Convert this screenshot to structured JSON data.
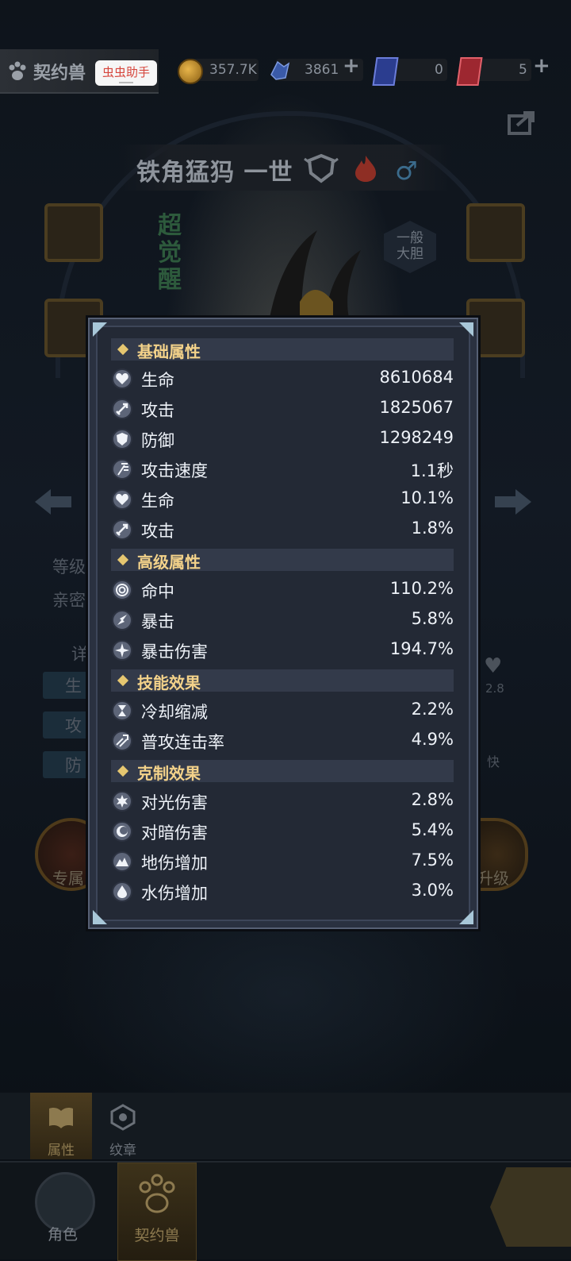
{
  "topbar": {
    "title": "契约兽",
    "helper_badge": "虫虫助手",
    "gold": "357.7K",
    "crystals": "3861",
    "card_blue": "0",
    "card_red": "5"
  },
  "scene": {
    "monster_name": "铁角猛犸 一世",
    "super_awaken": "超觉醒",
    "personality_line1": "一般",
    "personality_line2": "大胆",
    "level_label": "等级",
    "intimacy_label": "亲密",
    "detail_label": "详",
    "side_hp": "生",
    "side_atk": "攻",
    "side_def": "防",
    "right_value": "2.8",
    "right_fast": "快",
    "exclusive_label": "专属",
    "upgrade_label": "升级"
  },
  "subtabs": [
    {
      "label": "属性"
    },
    {
      "label": "纹章"
    }
  ],
  "nav": [
    {
      "label": "角色"
    },
    {
      "label": "契约兽"
    }
  ],
  "panel": {
    "sections": [
      {
        "title": "基础属性",
        "rows": [
          {
            "icon": "heart-icon",
            "name": "生命",
            "value": "8610684"
          },
          {
            "icon": "sword-icon",
            "name": "攻击",
            "value": "1825067"
          },
          {
            "icon": "shield-icon",
            "name": "防御",
            "value": "1298249"
          },
          {
            "icon": "attack-speed-icon",
            "name": "攻击速度",
            "value": "1.1秒"
          },
          {
            "icon": "heart-icon",
            "name": "生命",
            "value": "10.1%"
          },
          {
            "icon": "sword-icon",
            "name": "攻击",
            "value": "1.8%"
          }
        ]
      },
      {
        "title": "高级属性",
        "rows": [
          {
            "icon": "target-icon",
            "name": "命中",
            "value": "110.2%"
          },
          {
            "icon": "crit-icon",
            "name": "暴击",
            "value": "5.8%"
          },
          {
            "icon": "crit-damage-icon",
            "name": "暴击伤害",
            "value": "194.7%"
          }
        ]
      },
      {
        "title": "技能效果",
        "rows": [
          {
            "icon": "hourglass-icon",
            "name": "冷却缩减",
            "value": "2.2%"
          },
          {
            "icon": "combo-icon",
            "name": "普攻连击率",
            "value": "4.9%"
          }
        ]
      },
      {
        "title": "克制效果",
        "rows": [
          {
            "icon": "light-icon",
            "name": "对光伤害",
            "value": "2.8%"
          },
          {
            "icon": "dark-icon",
            "name": "对暗伤害",
            "value": "5.4%"
          },
          {
            "icon": "earth-icon",
            "name": "地伤增加",
            "value": "7.5%"
          },
          {
            "icon": "water-icon",
            "name": "水伤增加",
            "value": "3.0%"
          }
        ]
      }
    ]
  },
  "colors": {
    "panel_bg": "#232935",
    "section_header": "#f3d28a",
    "helper_text": "#d6453c"
  }
}
